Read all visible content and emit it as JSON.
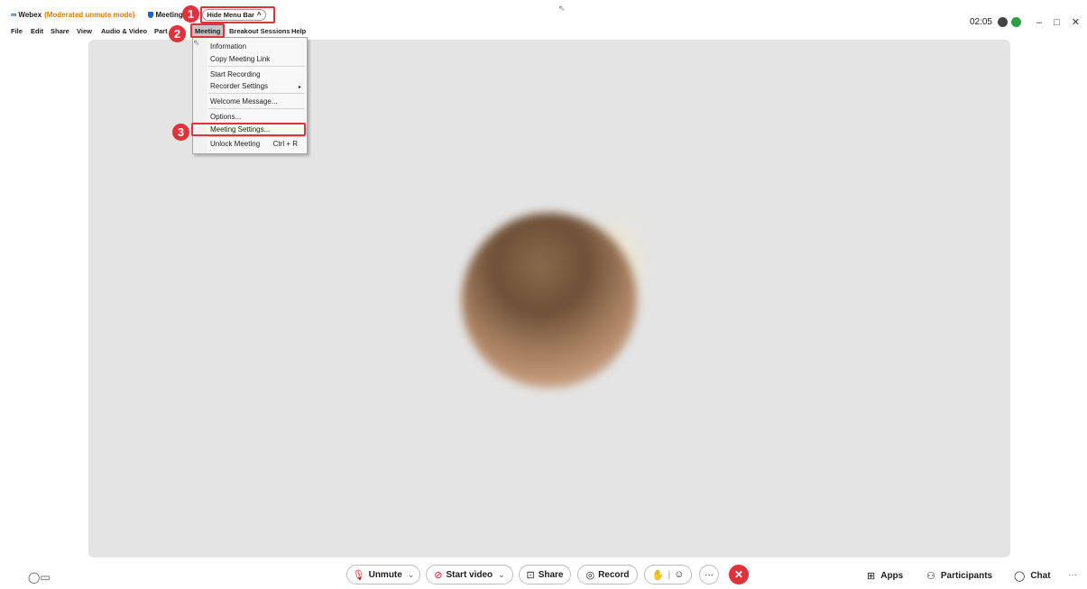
{
  "titlebar": {
    "app_name": "Webex",
    "mode": "(Moderated unmute mode)",
    "meeting_label": "Meeting",
    "hide_menu_label": "Hide Menu Bar",
    "hide_menu_chevron": "^",
    "clock": "02:05",
    "minimize": "–",
    "restore": "□",
    "close": "✕"
  },
  "menubar": {
    "items": [
      "File",
      "Edit",
      "Share",
      "View",
      "Audio & Video",
      "Part",
      "Meeting",
      "Breakout Sessions",
      "Help"
    ]
  },
  "meeting_menu": {
    "items": [
      {
        "label": "Information"
      },
      {
        "label": "Copy Meeting Link"
      },
      {
        "label": "Start Recording"
      },
      {
        "label": "Recorder Settings",
        "has_submenu": true
      },
      {
        "label": "Welcome Message..."
      },
      {
        "label": "Options..."
      },
      {
        "label": "Meeting Settings..."
      },
      {
        "label": "Unlock Meeting",
        "shortcut": "Ctrl + R"
      }
    ]
  },
  "annotations": {
    "badges": [
      "1",
      "2",
      "3"
    ],
    "highlight_color": "#e0323a"
  },
  "toolbar": {
    "unmute": "Unmute",
    "start_video": "Start video",
    "share": "Share",
    "record": "Record",
    "more": "···",
    "end": "✕",
    "apps": "Apps",
    "participants": "Participants",
    "chat": "Chat",
    "overflow": "···"
  },
  "colors": {
    "accent_red": "#e0323a",
    "stage_bg": "#e4e4e4",
    "mode_orange": "#d97a00",
    "brand_blue": "#0a56c8"
  }
}
